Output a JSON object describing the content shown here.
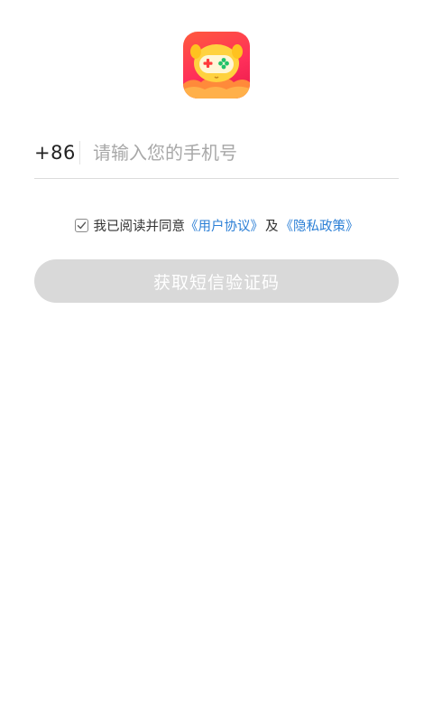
{
  "app": {
    "logo_icon": "game-controller-mascot-icon",
    "logo_colors": [
      "#ff5a3c",
      "#e8184a",
      "#ffd23f"
    ]
  },
  "phone": {
    "country_code": "+86",
    "placeholder": "请输入您的手机号",
    "value": ""
  },
  "agreement": {
    "checked": true,
    "prefix": "我已阅读并同意",
    "user_agreement": "《用户协议》",
    "connector": "及",
    "privacy_policy": "《隐私政策》",
    "link_color": "#2b7fd6"
  },
  "submit": {
    "label": "获取短信验证码",
    "enabled": false,
    "color": "#d9d9d9"
  }
}
